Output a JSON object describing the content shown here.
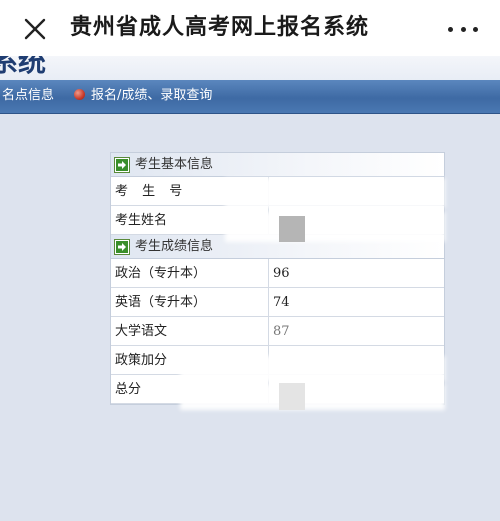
{
  "header": {
    "title": "贵州省成人高考网上报名系统"
  },
  "banner": {
    "text": "系统"
  },
  "nav": {
    "items": [
      {
        "label": "名点信息"
      },
      {
        "label": "报名/成绩、录取查询"
      }
    ]
  },
  "basic_info": {
    "heading": "考生基本信息",
    "rows": [
      {
        "label": "考 生 号",
        "value": ""
      },
      {
        "label": "考生姓名",
        "value": ""
      }
    ]
  },
  "score_info": {
    "heading": "考生成绩信息",
    "rows": [
      {
        "label": "政治（专升本）",
        "value": "96"
      },
      {
        "label": "英语（专升本）",
        "value": "74"
      },
      {
        "label": "大学语文",
        "value": "87"
      },
      {
        "label": "政策加分",
        "value": ""
      },
      {
        "label": "总分",
        "value": ""
      }
    ]
  },
  "colors": {
    "nav_bar": "#3e6aa4",
    "page_bg": "#dde3ee",
    "arrow_icon": "#3a8f2a"
  }
}
